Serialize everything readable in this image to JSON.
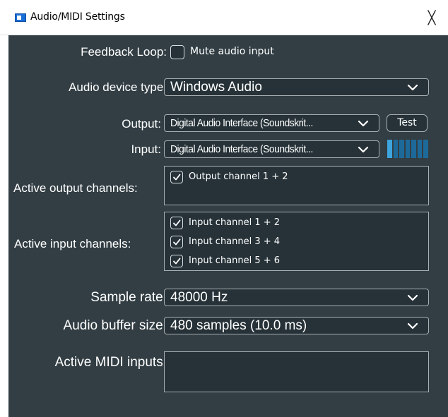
{
  "window": {
    "title": "Audio/MIDI Settings",
    "close_glyph": "╳"
  },
  "feedback": {
    "label": "Feedback Loop:",
    "checkbox_label": "Mute audio input",
    "checked": false
  },
  "device_type": {
    "label": "Audio device type:",
    "value": "Windows Audio"
  },
  "output": {
    "label": "Output:",
    "value": "Digital Audio Interface (Soundskrit...",
    "test_label": "Test"
  },
  "input": {
    "label": "Input:",
    "value": "Digital Audio Interface (Soundskrit...",
    "meter_level": 0.14
  },
  "active_output": {
    "label": "Active output channels:",
    "channels": [
      {
        "label": "Output channel 1 + 2",
        "checked": true
      }
    ]
  },
  "active_input": {
    "label": "Active input channels:",
    "channels": [
      {
        "label": "Input channel 1 + 2",
        "checked": true
      },
      {
        "label": "Input channel 3 + 4",
        "checked": true
      },
      {
        "label": "Input channel 5 + 6",
        "checked": true
      }
    ]
  },
  "sample_rate": {
    "label": "Sample rate:",
    "value": "48000 Hz"
  },
  "buffer_size": {
    "label": "Audio buffer size:",
    "value": "480 samples (10.0 ms)"
  },
  "midi_inputs": {
    "label": "Active MIDI inputs:",
    "items": []
  },
  "colors": {
    "panel_bg": "#323e44",
    "control_bg": "#263238",
    "border": "#a8b0b4",
    "meter_lit": "#3da4dd",
    "meter_dim": "#1d6a9a"
  },
  "icons": {
    "app": "app-window-icon",
    "close": "close-icon",
    "dropdown": "chevron-down-icon",
    "check": "checkmark-icon"
  }
}
